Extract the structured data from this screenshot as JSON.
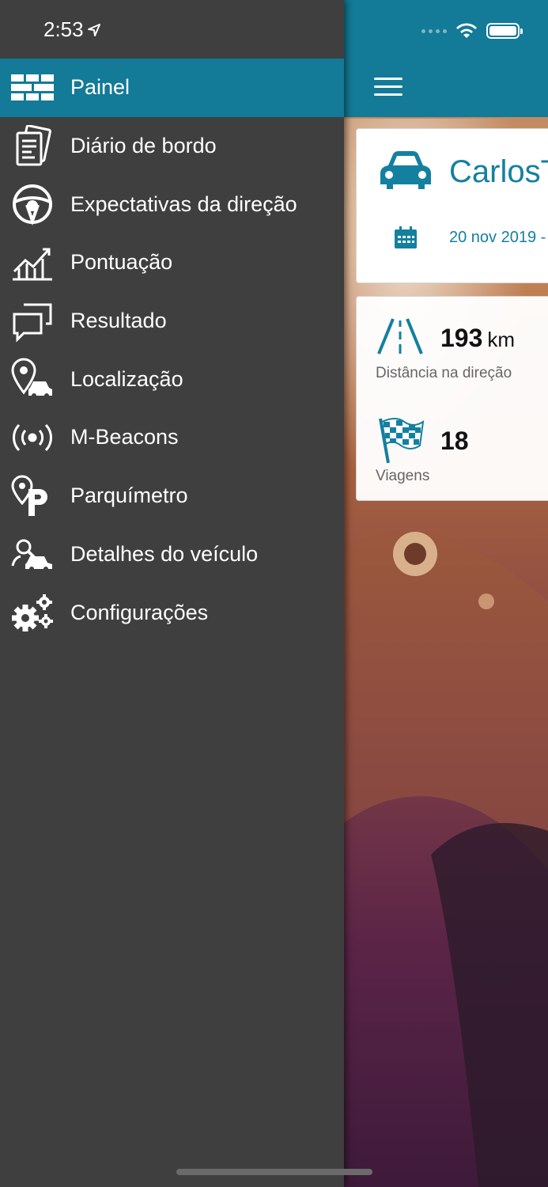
{
  "status_bar": {
    "time": "2:53"
  },
  "drawer": {
    "items": [
      {
        "label": "Painel",
        "icon": "dashboard-icon",
        "active": true
      },
      {
        "label": "Diário de bordo",
        "icon": "logbook-icon",
        "active": false
      },
      {
        "label": "Expectativas da direção",
        "icon": "steering-wheel-icon",
        "active": false
      },
      {
        "label": "Pontuação",
        "icon": "score-chart-icon",
        "active": false
      },
      {
        "label": "Resultado",
        "icon": "result-chat-icon",
        "active": false
      },
      {
        "label": "Localização",
        "icon": "location-car-icon",
        "active": false
      },
      {
        "label": "M-Beacons",
        "icon": "beacon-icon",
        "active": false
      },
      {
        "label": "Parquímetro",
        "icon": "parking-icon",
        "active": false
      },
      {
        "label": "Detalhes do veículo",
        "icon": "vehicle-details-icon",
        "active": false
      },
      {
        "label": "Configurações",
        "icon": "settings-gears-icon",
        "active": false
      }
    ]
  },
  "dashboard": {
    "user_name": "CarlosT",
    "date": "20 nov 2019 -",
    "distance_value": "193",
    "distance_unit": "km",
    "distance_label": "Distância na direção",
    "trips_value": "18",
    "trips_label": "Viagens"
  },
  "colors": {
    "accent": "#137a97",
    "drawer_bg": "#3f3f3f",
    "text_accent": "#1480a0"
  }
}
